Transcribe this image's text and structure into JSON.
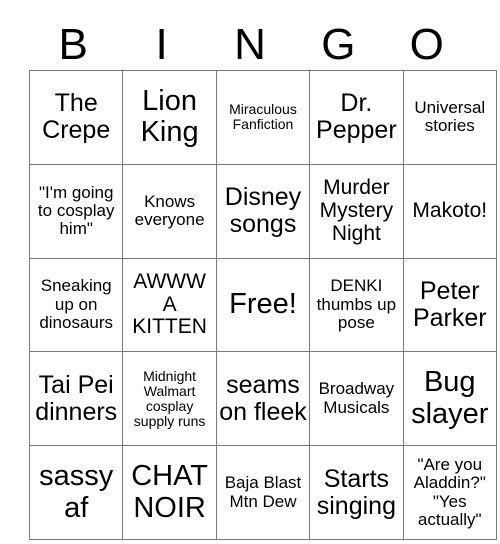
{
  "card": {
    "header_letters": [
      "B",
      "I",
      "N",
      "G",
      "O"
    ],
    "free_space_label": "Free!",
    "colors": {
      "background": "#ffffff",
      "text": "#000000",
      "grid_line": "#7a7a7a"
    },
    "rows": [
      [
        {
          "text": "The Crepe",
          "size": "sz-xl"
        },
        {
          "text": "Lion King",
          "size": "sz-xxl"
        },
        {
          "text": "Miraculous Fanfiction",
          "size": "sz-s"
        },
        {
          "text": "Dr. Pepper",
          "size": "sz-xl"
        },
        {
          "text": "Universal stories",
          "size": "sz-m"
        }
      ],
      [
        {
          "text": "\"I'm going to cosplay him\"",
          "size": "sz-m"
        },
        {
          "text": "Knows everyone",
          "size": "sz-m"
        },
        {
          "text": "Disney songs",
          "size": "sz-xl"
        },
        {
          "text": "Murder Mystery Night",
          "size": "sz-l"
        },
        {
          "text": "Makoto!",
          "size": "sz-l"
        }
      ],
      [
        {
          "text": "Sneaking up on dinosaurs",
          "size": "sz-m"
        },
        {
          "text": "AWWW A KITTEN",
          "size": "sz-l"
        },
        {
          "text": "Free!",
          "size": "sz-xxl"
        },
        {
          "text": "DENKI thumbs up pose",
          "size": "sz-m"
        },
        {
          "text": "Peter Parker",
          "size": "sz-xl"
        }
      ],
      [
        {
          "text": "Tai Pei dinners",
          "size": "sz-xl"
        },
        {
          "text": "Midnight Walmart cosplay supply runs",
          "size": "sz-s"
        },
        {
          "text": "seams on fleek",
          "size": "sz-xl"
        },
        {
          "text": "Broadway Musicals",
          "size": "sz-m"
        },
        {
          "text": "Bug slayer",
          "size": "sz-xxl"
        }
      ],
      [
        {
          "text": "sassy af",
          "size": "sz-xxl"
        },
        {
          "text": "CHAT NOIR",
          "size": "sz-xxl"
        },
        {
          "text": "Baja Blast Mtn Dew",
          "size": "sz-m"
        },
        {
          "text": "Starts singing",
          "size": "sz-xl"
        },
        {
          "text": "\"Are you Aladdin?\" \"Yes actually\"",
          "size": "sz-m"
        }
      ]
    ]
  }
}
